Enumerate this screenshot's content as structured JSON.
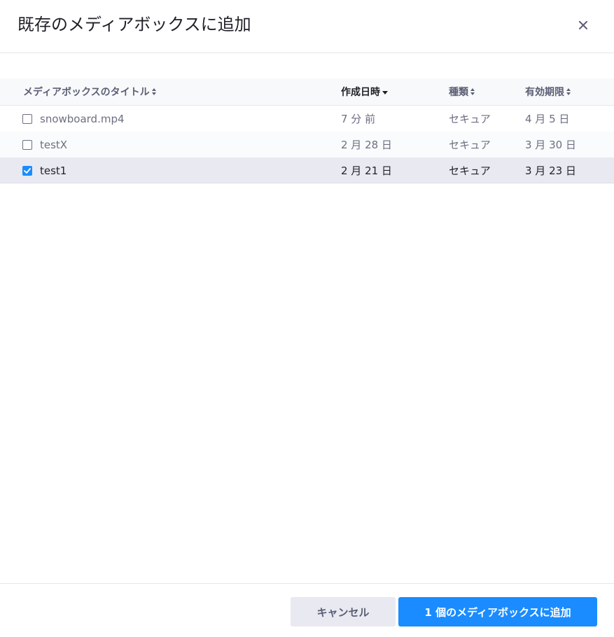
{
  "dialog": {
    "title": "既存のメディアボックスに追加",
    "close_icon": "close-icon"
  },
  "table": {
    "columns": [
      {
        "label": "メディアボックスのタイトル",
        "sort": "both"
      },
      {
        "label": "作成日時",
        "sort": "desc"
      },
      {
        "label": "種類",
        "sort": "both"
      },
      {
        "label": "有効期限",
        "sort": "both"
      }
    ],
    "rows": [
      {
        "title": "snowboard.mp4",
        "created": "7 分 前",
        "type": "セキュア",
        "expiry": "4 月 5 日",
        "checked": false
      },
      {
        "title": "testX",
        "created": "2 月 28 日",
        "type": "セキュア",
        "expiry": "3 月 30 日",
        "checked": false
      },
      {
        "title": "test1",
        "created": "2 月 21 日",
        "type": "セキュア",
        "expiry": "3 月 23 日",
        "checked": true
      }
    ]
  },
  "footer": {
    "cancel_label": "キャンセル",
    "add_label": "1 個のメディアボックスに追加"
  },
  "colors": {
    "accent": "#1a8cff",
    "selected_row": "#e8e9f1",
    "header_bg": "#f8f9fb"
  }
}
